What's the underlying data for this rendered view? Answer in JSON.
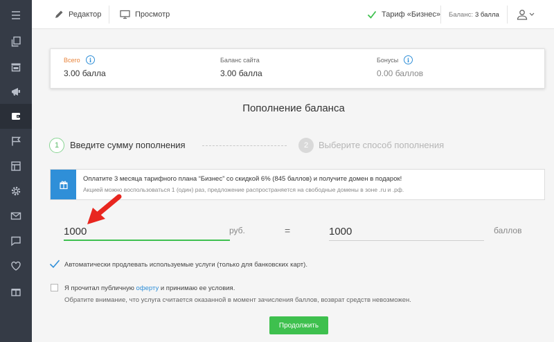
{
  "sidebar": {
    "items": [
      {
        "icon": "menu-icon"
      },
      {
        "icon": "pages-icon"
      },
      {
        "icon": "store-icon"
      },
      {
        "icon": "megaphone-icon"
      },
      {
        "icon": "wallet-icon",
        "active": true
      },
      {
        "icon": "flag-icon"
      },
      {
        "icon": "layout-icon"
      },
      {
        "icon": "gear-icon"
      },
      {
        "icon": "mail-icon"
      },
      {
        "icon": "chat-icon"
      },
      {
        "icon": "heart-icon"
      },
      {
        "icon": "gift-icon"
      }
    ]
  },
  "topbar": {
    "editor_label": "Редактор",
    "preview_label": "Просмотр",
    "plan_label": "Тариф «Бизнес»",
    "balance_label": "Баланс:",
    "balance_value": "3 балла"
  },
  "balance_card": {
    "total_label": "Всего",
    "total_value": "3.00 балла",
    "site_label": "Баланс сайта",
    "site_value": "3.00 балла",
    "bonus_label": "Бонусы",
    "bonus_value": "0.00 баллов"
  },
  "page_title": "Пополнение баланса",
  "steps": [
    {
      "number": "1",
      "label": "Введите сумму пополнения"
    },
    {
      "number": "2",
      "label": "Выберите способ пополнения"
    }
  ],
  "promo": {
    "main": "Оплатите 3 месяца тарифного плана “Бизнес” со скидкой 6% (845 баллов) и получите домен в подарок!",
    "sub": "Акцией можно воспользоваться 1 (один) раз, предложение распространяется на свободные домены в зоне .ru и .рф."
  },
  "form": {
    "amount_value": "1000",
    "amount_unit": "руб.",
    "equals": "=",
    "points_value": "1000",
    "points_unit": "баллов",
    "auto_renew_label": "Автоматически продлевать используемые услуги (только для банковских карт).",
    "offer_prefix": "Я прочитал публичную",
    "offer_link": "оферту",
    "offer_suffix": "и принимаю ее условия.",
    "note": "Обратите внимание, что услуга считается оказанной в момент зачисления баллов, возврат средств невозможен.",
    "continue_label": "Продолжить"
  },
  "colors": {
    "accent_green": "#3ec04e",
    "accent_blue": "#2f8fd8",
    "annotation_red": "#e8261f",
    "sidebar_bg": "#353b46"
  }
}
